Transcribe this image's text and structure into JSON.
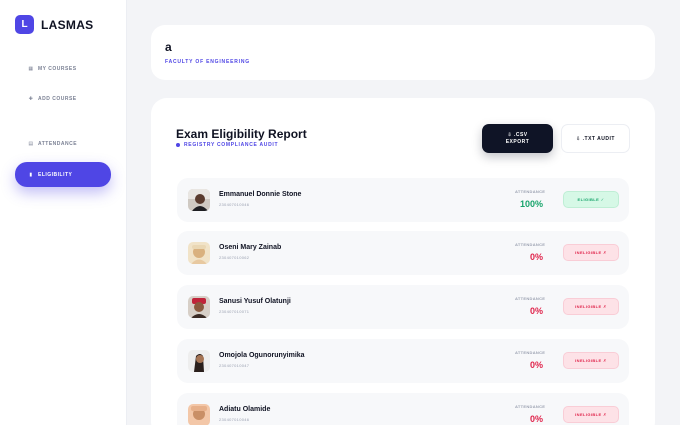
{
  "brand": {
    "logo_letter": "L",
    "name": "LASMAS"
  },
  "nav": [
    {
      "label": "MY COURSES",
      "icon": "grid-icon",
      "glyph": "▦"
    },
    {
      "label": "ADD COURSE",
      "icon": "plus-icon",
      "glyph": "✚"
    },
    {
      "label": "ATTENDANCE",
      "icon": "calendar-icon",
      "glyph": "▤"
    },
    {
      "label": "ELIGIBILITY",
      "icon": "report-icon",
      "glyph": "▮"
    }
  ],
  "header": {
    "title": "a",
    "subtitle": "FACULTY OF ENGINEERING"
  },
  "report": {
    "title": "Exam Eligibility Report",
    "subtitle": "REGISTRY COMPLIANCE AUDIT",
    "csv_line1": "⇩ .CSV",
    "csv_line2": "EXPORT",
    "txt_label": "⇩ .TXT AUDIT"
  },
  "attendance_label": "ATTENDANCE",
  "students": [
    {
      "name": "Emmanuel Donnie Stone",
      "id": "230407010046",
      "attendance": "100%",
      "status": "ELIGIBLE ✓",
      "eligible": true
    },
    {
      "name": "Oseni Mary Zainab",
      "id": "230407010062",
      "attendance": "0%",
      "status": "INELIGIBLE ✗",
      "eligible": false
    },
    {
      "name": "Sanusi Yusuf Olatunji",
      "id": "230407010071",
      "attendance": "0%",
      "status": "INELIGIBLE ✗",
      "eligible": false
    },
    {
      "name": "Omojola Ogunorunyimika",
      "id": "230407010047",
      "attendance": "0%",
      "status": "INELIGIBLE ✗",
      "eligible": false
    },
    {
      "name": "Adiatu Olamide",
      "id": "230407010046",
      "attendance": "0%",
      "status": "INELIGIBLE ✗",
      "eligible": false
    }
  ],
  "colors": {
    "accent": "#4f46e5",
    "good": "#18a46b",
    "bad": "#e0244b",
    "dark": "#0f1426"
  }
}
